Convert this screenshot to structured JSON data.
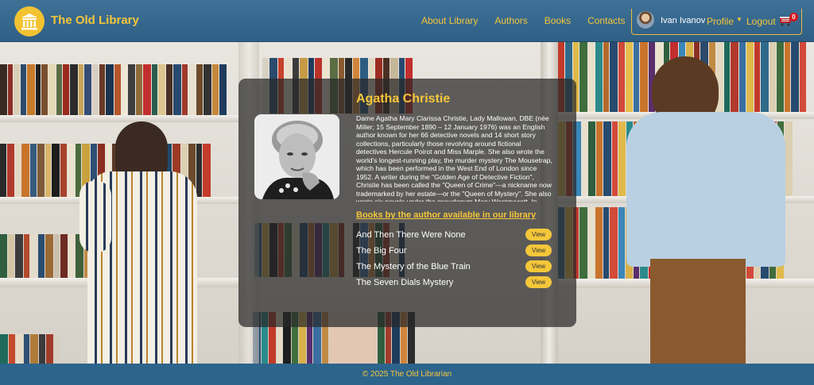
{
  "brand": {
    "name": "The Old Library"
  },
  "nav": {
    "items": [
      "About Library",
      "Authors",
      "Books",
      "Contacts"
    ]
  },
  "user": {
    "name": "Ivan Ivanov",
    "profile_label": "Profile",
    "logout_label": "Logout",
    "cart_count": "0"
  },
  "author": {
    "name": "Agatha Christie",
    "bio": "Dame Agatha Mary Clarissa Christie, Lady Mallowan, DBE (née Miller; 15 September 1890 – 12 January 1976) was an English author known for her 66 detective novels and 14 short story collections, particularly those revolving around fictional detectives Hercule Poirot and Miss Marple. She also wrote the world's longest-running play, the murder mystery The Mousetrap, which has been performed in the West End of London since 1952. A writer during the \"Golden Age of Detective Fiction\", Christie has been called the \"Queen of Crime\"—a nickname now trademarked by her estate—or the \"Queen of Mystery\". She also wrote six novels under the pseudonym Mary Westmacott. In"
  },
  "books_section": {
    "heading": "Books by the author available in our library",
    "view_label": "View",
    "books": [
      "And Then There Were None",
      "The Big Four",
      "The Mystery of the Blue Train",
      "The Seven Dials Mystery"
    ]
  },
  "footer": {
    "text": "© 2025 The Old Librarian"
  },
  "colors": {
    "accent": "#f4c63a",
    "header": "#2f5f85",
    "badge": "#d3171d"
  },
  "icons": [
    "library-columns-icon",
    "chevron-down-icon",
    "cart-icon"
  ]
}
